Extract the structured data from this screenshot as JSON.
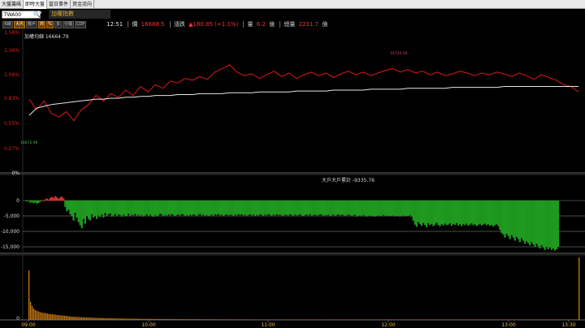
{
  "tabs": [
    {
      "label": "大盤籌碼",
      "active": false
    },
    {
      "label": "即時大盤",
      "active": true
    },
    {
      "label": "當日事件",
      "active": false
    },
    {
      "label": "資金流向",
      "active": false
    }
  ],
  "symbol": {
    "code": "TWA00",
    "name": "加權指數"
  },
  "toolbar": [
    {
      "label": "K線",
      "selected": false
    },
    {
      "label": "大內",
      "selected": true
    },
    {
      "label": "散戶",
      "selected": false
    },
    {
      "label": "商",
      "selected": true
    },
    {
      "label": "%",
      "selected": true
    },
    {
      "label": "多",
      "selected": false
    },
    {
      "label": "分價",
      "selected": false
    },
    {
      "label": "CDP",
      "selected": false
    }
  ],
  "quote": {
    "time": "12:51",
    "price_label": "價",
    "price": "16688.5",
    "change_label": "漲跌",
    "change": "▲180.85 (+1.1%)",
    "volume_label": "量",
    "volume": "6.2",
    "volume_unit": "億",
    "total_label": "總量",
    "total": "2231.7",
    "total_unit": "億"
  },
  "chart_data": {
    "type": "line",
    "price_panel": {
      "title": "加權均線 16664.79",
      "y_ticks": [
        "1.56%",
        "1.36%",
        "1.09%",
        "0.83%",
        "0.55%",
        "0.27%",
        "0%"
      ],
      "high_label": "16720.56",
      "low_label": "16672.96",
      "series": [
        {
          "color": "#e01818",
          "values": [
            0.82,
            0.7,
            0.8,
            0.66,
            0.62,
            0.68,
            0.58,
            0.7,
            0.76,
            0.86,
            0.8,
            0.88,
            0.84,
            0.92,
            0.86,
            0.96,
            0.9,
            0.98,
            0.94,
            1.02,
            1.0,
            1.05,
            1.03,
            1.07,
            1.04,
            1.12,
            1.16,
            1.2,
            1.12,
            1.08,
            1.1,
            1.05,
            1.09,
            1.13,
            1.07,
            1.11,
            1.05,
            1.09,
            1.12,
            1.08,
            1.11,
            1.06,
            1.1,
            1.13,
            1.09,
            1.12,
            1.08,
            1.11,
            1.14,
            1.16,
            1.12,
            1.15,
            1.11,
            1.13,
            1.09,
            1.12,
            1.08,
            1.1,
            1.13,
            1.11,
            1.08,
            1.11,
            1.09,
            1.12,
            1.1,
            1.07,
            1.11,
            1.08,
            1.04,
            1.09,
            1.06,
            1.03,
            0.98,
            0.96,
            0.9
          ]
        },
        {
          "color": "#e8e8e8",
          "values": [
            0.64,
            0.72,
            0.74,
            0.76,
            0.77,
            0.78,
            0.79,
            0.8,
            0.81,
            0.82,
            0.82,
            0.83,
            0.83,
            0.84,
            0.84,
            0.85,
            0.85,
            0.86,
            0.86,
            0.86,
            0.87,
            0.87,
            0.87,
            0.88,
            0.88,
            0.88,
            0.88,
            0.89,
            0.89,
            0.89,
            0.89,
            0.9,
            0.9,
            0.9,
            0.9,
            0.9,
            0.91,
            0.91,
            0.91,
            0.91,
            0.91,
            0.92,
            0.92,
            0.92,
            0.92,
            0.92,
            0.93,
            0.93,
            0.93,
            0.93,
            0.93,
            0.94,
            0.94,
            0.94,
            0.94,
            0.94,
            0.94,
            0.95,
            0.95,
            0.95,
            0.95,
            0.95,
            0.95,
            0.95,
            0.96,
            0.96,
            0.96,
            0.96,
            0.96,
            0.96,
            0.96,
            0.96,
            0.96,
            0.96,
            0.96
          ]
        }
      ]
    },
    "flow_panel": {
      "title": "大戶大戶累計 -9335.76",
      "y_ticks": [
        "0",
        "-5,000",
        "-10,000",
        "-15,000"
      ],
      "values": [
        0,
        -300,
        -200,
        -700,
        -500,
        -900,
        -600,
        -1000,
        -800,
        -400,
        200,
        -200,
        400,
        700,
        300,
        900,
        1200,
        800,
        1400,
        1100,
        600,
        1000,
        1300,
        700,
        -2000,
        -3500,
        -3000,
        -4500,
        -5000,
        -6500,
        -4000,
        -5500,
        -7000,
        -8000,
        -9000,
        -6000,
        -7500,
        -5000,
        -6000,
        -6500,
        -4500,
        -5500,
        -5000,
        -6000,
        -4800,
        -5300,
        -4500,
        -5500,
        -4000,
        -5000,
        -4500,
        -4200,
        -5200,
        -4800,
        -4400,
        -5000,
        -4500,
        -4700,
        -5200,
        -4600,
        -4900,
        -5100,
        -4300,
        -5000,
        -4600,
        -4800,
        -4400,
        -4900,
        -4600,
        -5000,
        -4700,
        -5200,
        -4800,
        -4500,
        -5000,
        -4600,
        -4900,
        -5300,
        -4700,
        -5100,
        -4800,
        -4300,
        -4600,
        -5000,
        -4700,
        -4900,
        -4500,
        -4800,
        -4400,
        -4700,
        -5100,
        -4700,
        -4500,
        -4800,
        -4400,
        -4600,
        -5000,
        -4700,
        -4900,
        -4600,
        -4800,
        -4500,
        -4700,
        -5000,
        -4600,
        -4400,
        -4800,
        -4600,
        -4900,
        -4700,
        -5100,
        -4800,
        -4600,
        -4900,
        -4500,
        -4700,
        -4400,
        -4800,
        -4600,
        -4900,
        -4700,
        -4500,
        -4800,
        -4600,
        -4700,
        -4900,
        -4600,
        -4800,
        -4400,
        -4700,
        -4500,
        -4800,
        -4600,
        -4900,
        -4700,
        -4500,
        -4800,
        -4600,
        -5000,
        -4700,
        -4800,
        -4500,
        -4700,
        -4900,
        -4600,
        -4800,
        -4400,
        -4700,
        -4900,
        -4600,
        -4800,
        -4500,
        -4700,
        -4600,
        -4800,
        -4900,
        -4600,
        -4700,
        -4800,
        -4500,
        -4700,
        -4900,
        -4600,
        -4800,
        -4700,
        -4500,
        -4800,
        -5000,
        -4700,
        -4600,
        -4800,
        -4500,
        -4900,
        -4700,
        -4600,
        -4800,
        -4700,
        -4500,
        -4600,
        -4900,
        -4700,
        -4800,
        -4600,
        -5000,
        -4800,
        -4600,
        -4900,
        -4700,
        -4500,
        -4800,
        -4600,
        -4700,
        -4900,
        -4800,
        -4600,
        -4700,
        -4900,
        -4800,
        -4600,
        -5200,
        -4900,
        -4800,
        -5100,
        -4700,
        -4900,
        -5200,
        -5000,
        -4800,
        -5100,
        -4900,
        -5200,
        -5000,
        -4800,
        -5100,
        -4900,
        -4700,
        -5000,
        -4800,
        -5100,
        -4900,
        -5000,
        -4800,
        -5100,
        -5000,
        -4900,
        -5200,
        -5000,
        -4800,
        -5100,
        -4900,
        -5000,
        -4700,
        -5200,
        -6500,
        -7800,
        -8500,
        -7000,
        -7600,
        -8200,
        -7300,
        -7900,
        -8600,
        -7400,
        -8000,
        -7600,
        -8300,
        -7800,
        -7200,
        -7900,
        -8400,
        -7700,
        -8100,
        -7500,
        -8000,
        -7800,
        -7400,
        -8200,
        -7600,
        -7900,
        -7300,
        -8100,
        -7700,
        -8300,
        -7600,
        -8000,
        -7500,
        -8200,
        -7800,
        -7400,
        -8000,
        -7700,
        -8300,
        -7900,
        -7600,
        -8100,
        -7800,
        -7500,
        -8000,
        -7700,
        -8200,
        -7900,
        -8400,
        -8000,
        -7700,
        -8300,
        -9500,
        -10500,
        -11000,
        -12000,
        -10800,
        -11500,
        -12500,
        -11200,
        -12000,
        -13000,
        -11800,
        -12500,
        -13500,
        -12200,
        -13000,
        -14000,
        -13200,
        -13800,
        -14500,
        -13500,
        -14200,
        -15000,
        -14000,
        -14800,
        -15500,
        -14500,
        -15200,
        -16000,
        -15000,
        -15800,
        -15200,
        -16000,
        -15500,
        -16200,
        -15800,
        -15000
      ]
    },
    "volume_panel": {
      "y_ticks": [
        "0"
      ],
      "values": [
        3000,
        1100,
        850,
        700,
        600,
        560,
        520,
        480,
        450,
        430,
        420,
        400,
        380,
        360,
        350,
        340,
        330,
        320,
        300,
        290,
        280,
        270,
        260,
        250,
        240,
        230,
        220,
        210,
        200,
        190,
        185,
        180,
        175,
        170,
        165,
        160,
        155,
        150,
        145,
        140,
        140,
        135,
        130,
        125,
        120,
        118,
        115,
        112,
        110,
        108,
        105,
        102,
        100,
        98,
        95,
        92,
        90,
        88,
        86,
        84,
        82,
        80,
        78,
        76,
        75,
        74,
        72,
        71,
        70,
        69,
        68,
        67,
        66,
        65,
        64,
        63,
        62,
        61,
        60,
        59,
        58,
        57,
        56,
        55,
        54,
        53,
        52,
        52,
        51,
        50,
        50,
        49,
        48,
        48,
        47,
        47,
        46,
        45,
        45,
        44,
        44,
        43,
        43,
        42,
        42,
        41,
        41,
        40,
        40,
        40,
        39,
        39,
        38,
        38,
        38,
        37,
        37,
        36,
        36,
        36,
        35,
        35,
        35,
        34,
        34,
        34,
        33,
        33,
        33,
        32,
        32,
        32,
        31,
        31,
        31,
        30,
        30,
        30,
        30,
        29,
        29,
        29,
        28,
        28,
        28,
        28,
        27,
        27,
        27,
        27,
        26,
        26,
        26,
        26,
        25,
        25,
        25,
        25,
        24,
        24,
        24,
        24,
        24,
        23,
        23,
        23,
        23,
        22,
        22,
        22,
        22,
        22,
        21,
        21,
        21,
        21,
        21,
        20,
        20,
        20,
        20,
        20,
        20,
        19,
        19,
        19,
        19,
        19,
        19,
        18,
        18,
        18,
        18,
        18,
        18,
        18,
        17,
        17,
        17,
        17,
        17,
        17,
        17,
        16,
        16,
        16,
        16,
        16,
        16,
        16,
        15,
        15,
        15,
        15,
        15,
        15,
        15,
        15,
        14,
        14,
        14,
        14,
        14,
        14,
        14,
        14,
        13,
        13,
        13,
        13,
        13,
        13,
        13,
        13,
        13,
        12,
        12,
        12,
        12,
        12,
        12,
        12,
        12,
        12,
        12,
        11,
        11,
        11,
        11,
        11,
        11,
        11,
        11,
        11,
        11,
        11,
        10,
        10,
        10,
        10,
        10,
        10,
        10,
        10,
        10,
        10,
        10,
        10,
        9,
        9,
        9,
        9,
        9,
        9,
        9,
        9,
        9,
        9,
        9,
        9,
        9,
        8,
        8,
        8,
        8,
        8,
        8,
        8,
        8,
        8,
        8,
        8,
        8,
        8,
        8,
        7,
        7,
        7,
        7,
        7,
        7,
        7,
        7,
        7,
        7,
        7,
        7,
        7,
        7,
        7,
        6,
        6,
        6,
        6,
        6,
        6,
        6,
        6,
        6,
        6,
        6,
        6,
        6,
        6,
        6,
        6,
        5,
        5,
        5,
        5,
        5,
        5,
        5,
        5,
        5,
        5,
        5,
        5,
        5,
        5,
        5,
        5,
        5,
        5,
        4,
        4,
        4,
        4,
        4,
        4,
        4,
        4,
        4,
        4,
        3800
      ]
    },
    "x_ticks": [
      "09:00",
      "10:00",
      "11:00",
      "12:00",
      "13:00",
      "13:30"
    ]
  }
}
